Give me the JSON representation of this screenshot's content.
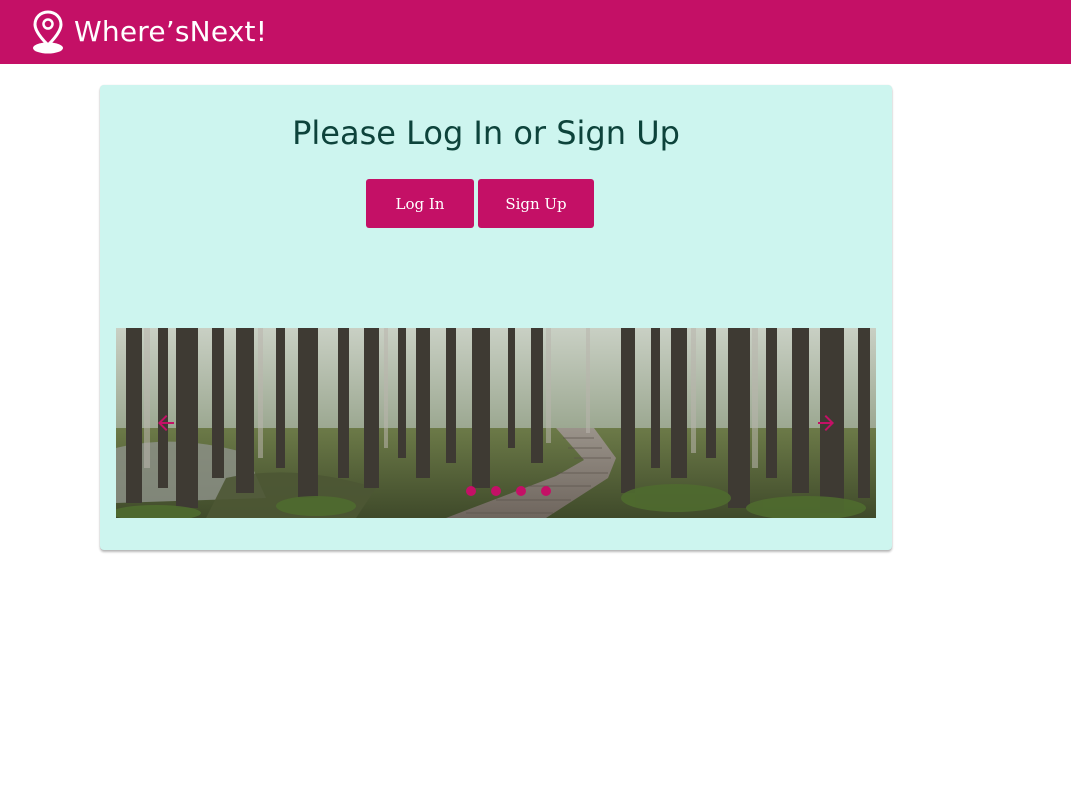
{
  "app": {
    "name": "Where’sNext!",
    "brand_color": "#c41066",
    "logo_icon": "map-pin-icon"
  },
  "login_card": {
    "title": "Please Log In or Sign Up",
    "background_color": "#cdf5ef",
    "buttons": {
      "login_label": "Log In",
      "signup_label": "Sign Up"
    }
  },
  "carousel": {
    "current_slide": "forest boardwalk trail",
    "slide_count": 4,
    "active_index": 0,
    "prev_icon": "arrow-left-icon",
    "next_icon": "arrow-right-icon",
    "indicator_color": "#c41066"
  }
}
